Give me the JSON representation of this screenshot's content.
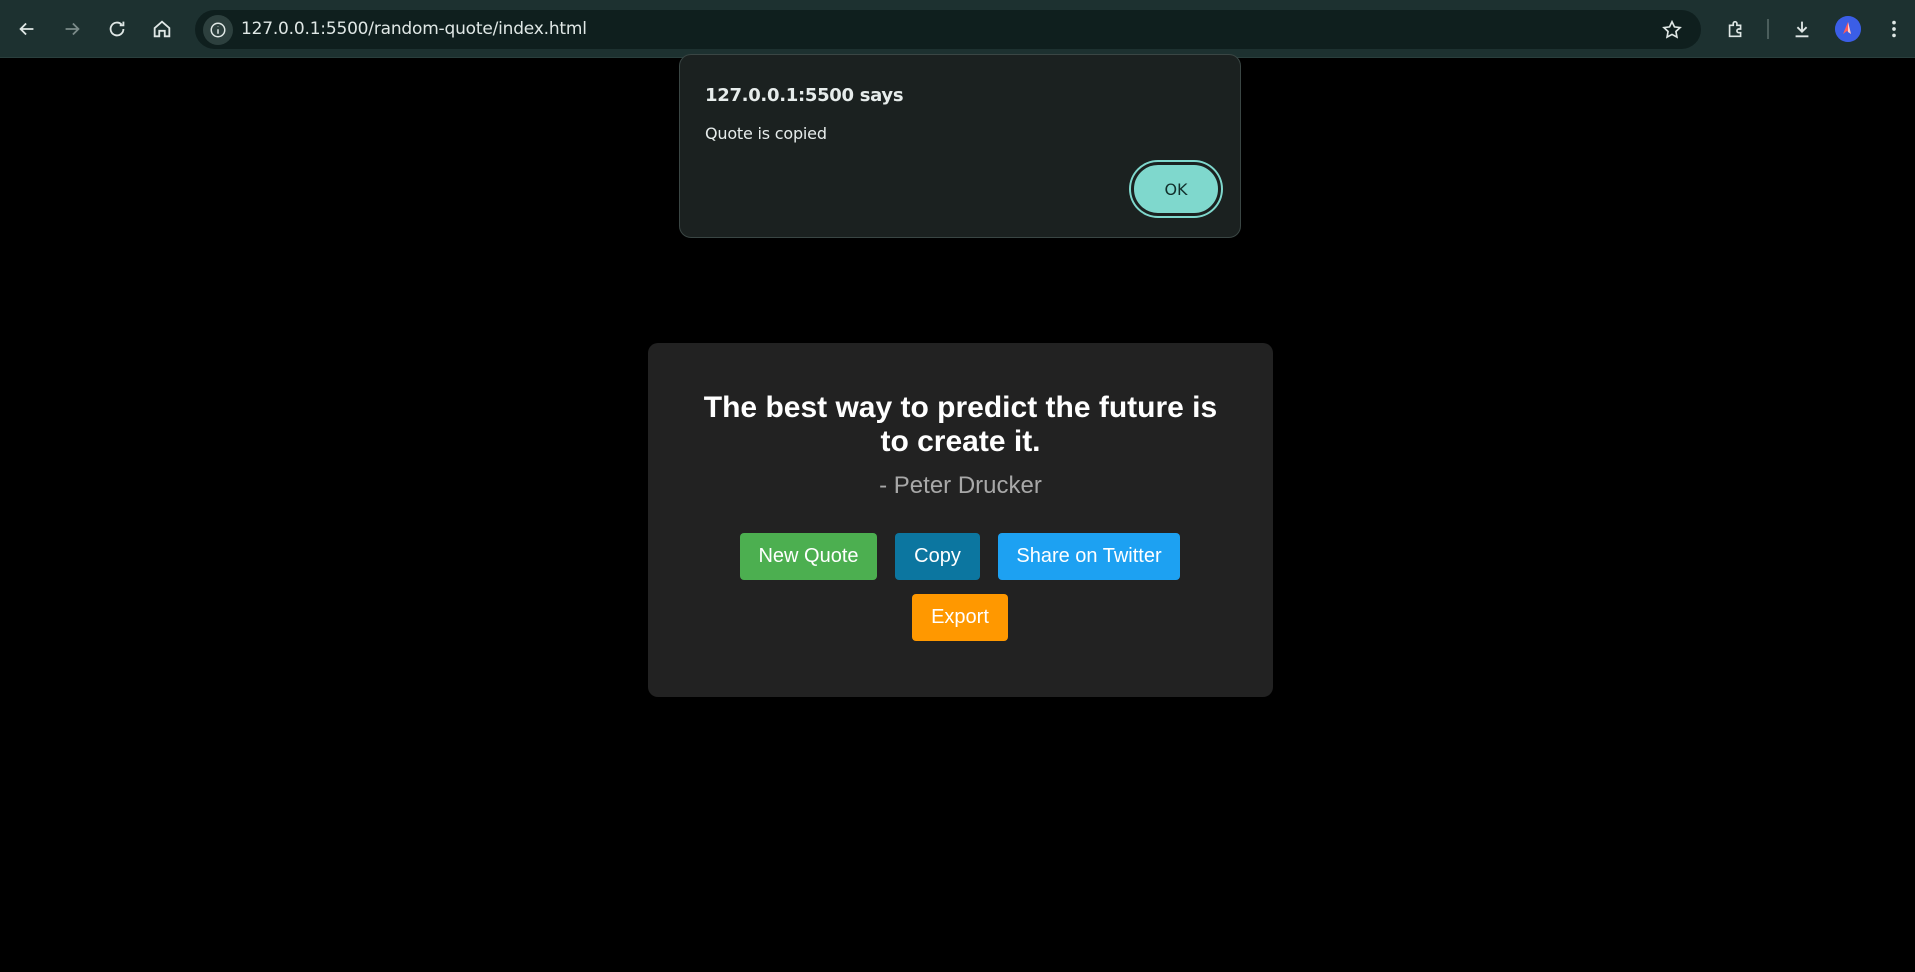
{
  "browser": {
    "url": "127.0.0.1:5500/random-quote/index.html",
    "icons": [
      "back-arrow-icon",
      "forward-arrow-icon",
      "reload-icon",
      "home-icon",
      "site-info-icon",
      "star-icon",
      "extensions-icon",
      "download-icon",
      "profile-avatar",
      "more-menu-icon"
    ]
  },
  "dialog": {
    "title": "127.0.0.1:5500 says",
    "message": "Quote is copied",
    "ok_label": "OK",
    "accent": "#7fd8cd"
  },
  "quote_card": {
    "quote": "The best way to predict the future is to create it.",
    "author": "- Peter Drucker",
    "buttons": {
      "new_quote": "New Quote",
      "copy": "Copy",
      "share": "Share on Twitter",
      "export": "Export"
    },
    "colors": {
      "new_quote": "#4caf50",
      "copy": "#0c76a0",
      "share": "#1da1f2",
      "export": "#ff9800"
    }
  }
}
